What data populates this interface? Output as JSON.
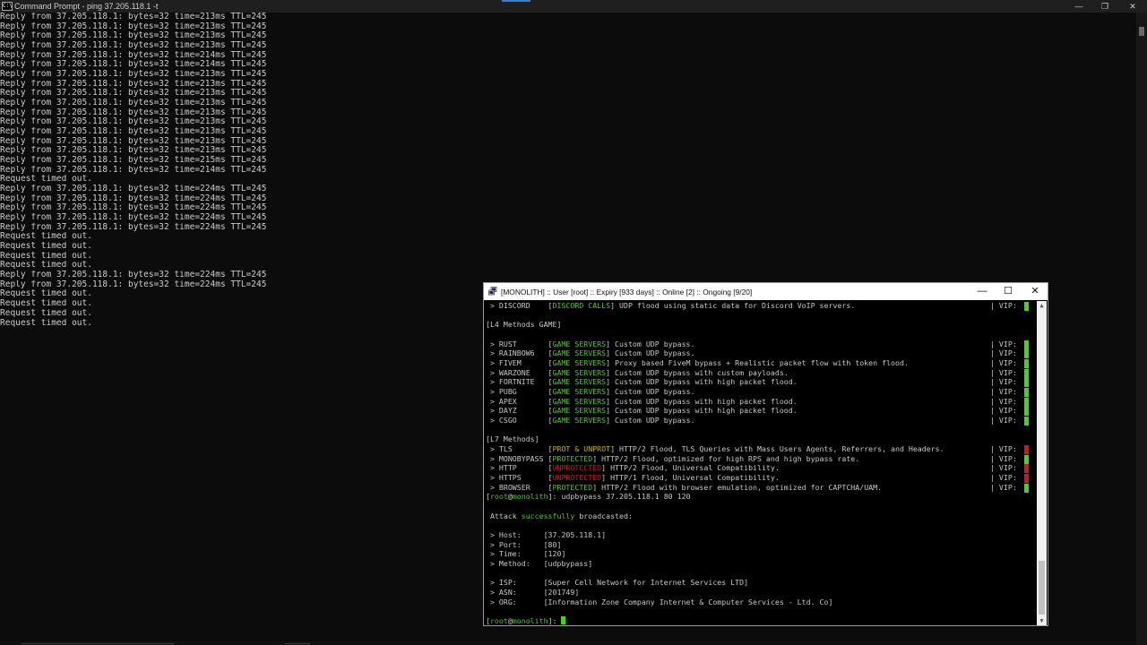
{
  "main_window": {
    "title": "Command Prompt - ping  37.205.118.1 -t",
    "controls": {
      "minimize": "—",
      "restore": "❐",
      "close": "✕"
    },
    "lines": [
      "Reply from 37.205.118.1: bytes=32 time=213ms TTL=245",
      "Reply from 37.205.118.1: bytes=32 time=213ms TTL=245",
      "Reply from 37.205.118.1: bytes=32 time=213ms TTL=245",
      "Reply from 37.205.118.1: bytes=32 time=213ms TTL=245",
      "Reply from 37.205.118.1: bytes=32 time=214ms TTL=245",
      "Reply from 37.205.118.1: bytes=32 time=214ms TTL=245",
      "Reply from 37.205.118.1: bytes=32 time=213ms TTL=245",
      "Reply from 37.205.118.1: bytes=32 time=213ms TTL=245",
      "Reply from 37.205.118.1: bytes=32 time=213ms TTL=245",
      "Reply from 37.205.118.1: bytes=32 time=213ms TTL=245",
      "Reply from 37.205.118.1: bytes=32 time=213ms TTL=245",
      "Reply from 37.205.118.1: bytes=32 time=213ms TTL=245",
      "Reply from 37.205.118.1: bytes=32 time=213ms TTL=245",
      "Reply from 37.205.118.1: bytes=32 time=213ms TTL=245",
      "Reply from 37.205.118.1: bytes=32 time=213ms TTL=245",
      "Reply from 37.205.118.1: bytes=32 time=215ms TTL=245",
      "Reply from 37.205.118.1: bytes=32 time=214ms TTL=245",
      "Request timed out.",
      "Reply from 37.205.118.1: bytes=32 time=224ms TTL=245",
      "Reply from 37.205.118.1: bytes=32 time=224ms TTL=245",
      "Reply from 37.205.118.1: bytes=32 time=224ms TTL=245",
      "Reply from 37.205.118.1: bytes=32 time=224ms TTL=245",
      "Reply from 37.205.118.1: bytes=32 time=224ms TTL=245",
      "Request timed out.",
      "Request timed out.",
      "Request timed out.",
      "Request timed out.",
      "Reply from 37.205.118.1: bytes=32 time=224ms TTL=245",
      "Reply from 37.205.118.1: bytes=32 time=224ms TTL=245",
      "Request timed out.",
      "Request timed out.",
      "Request timed out.",
      "Request timed out."
    ]
  },
  "putty_window": {
    "title": "[MONOLITH] :: User [root] :: Expiry [933 days] :: Online [2] :: Ongoing [9/20]",
    "controls": {
      "minimize": "—",
      "maximize": "☐",
      "close": "✕"
    },
    "colors": {
      "green": "#57c435",
      "yellow": "#c7b21b",
      "red": "#c62020",
      "vip_on": "#41d619",
      "vip_off": "#d01a1a"
    },
    "lines": [
      {
        "segs": [
          {
            "t": " > DISCORD    [",
            "c": "w"
          },
          {
            "t": "DISCORD CALLS",
            "c": "g"
          },
          {
            "t": "] UDP flood using static data for Discord VoIP servers.",
            "c": "w"
          }
        ],
        "vip": "on"
      },
      {
        "segs": []
      },
      {
        "segs": [
          {
            "t": "[L4 Methods GAME]",
            "c": "w"
          }
        ]
      },
      {
        "segs": []
      },
      {
        "segs": [
          {
            "t": " > RUST       [",
            "c": "w"
          },
          {
            "t": "GAME SERVERS",
            "c": "g"
          },
          {
            "t": "] Custom UDP bypass.",
            "c": "w"
          }
        ],
        "vip": "on"
      },
      {
        "segs": [
          {
            "t": " > RAINBOW6   [",
            "c": "w"
          },
          {
            "t": "GAME SERVERS",
            "c": "g"
          },
          {
            "t": "] Custom UDP bypass.",
            "c": "w"
          }
        ],
        "vip": "on"
      },
      {
        "segs": [
          {
            "t": " > FIVEM      [",
            "c": "w"
          },
          {
            "t": "GAME SERVERS",
            "c": "g"
          },
          {
            "t": "] Proxy based FiveM bypass + Realistic packet flow with token flood.",
            "c": "w"
          }
        ],
        "vip": "on"
      },
      {
        "segs": [
          {
            "t": " > WARZONE    [",
            "c": "w"
          },
          {
            "t": "GAME SERVERS",
            "c": "g"
          },
          {
            "t": "] Custom UDP bypass with custom payloads.",
            "c": "w"
          }
        ],
        "vip": "on"
      },
      {
        "segs": [
          {
            "t": " > FORTNITE   [",
            "c": "w"
          },
          {
            "t": "GAME SERVERS",
            "c": "g"
          },
          {
            "t": "] Custom UDP bypass with high packet flood.",
            "c": "w"
          }
        ],
        "vip": "on"
      },
      {
        "segs": [
          {
            "t": " > PUBG       [",
            "c": "w"
          },
          {
            "t": "GAME SERVERS",
            "c": "g"
          },
          {
            "t": "] Custom UDP bypass.",
            "c": "w"
          }
        ],
        "vip": "on"
      },
      {
        "segs": [
          {
            "t": " > APEX       [",
            "c": "w"
          },
          {
            "t": "GAME SERVERS",
            "c": "g"
          },
          {
            "t": "] Custom UDP bypass with high packet flood.",
            "c": "w"
          }
        ],
        "vip": "on"
      },
      {
        "segs": [
          {
            "t": " > DAYZ       [",
            "c": "w"
          },
          {
            "t": "GAME SERVERS",
            "c": "g"
          },
          {
            "t": "] Custom UDP bypass with high packet flood.",
            "c": "w"
          }
        ],
        "vip": "on"
      },
      {
        "segs": [
          {
            "t": " > CSGO       [",
            "c": "w"
          },
          {
            "t": "GAME SERVERS",
            "c": "g"
          },
          {
            "t": "] Custom UDP bypass.",
            "c": "w"
          }
        ],
        "vip": "on"
      },
      {
        "segs": []
      },
      {
        "segs": [
          {
            "t": "[L7 Methods]",
            "c": "w"
          }
        ]
      },
      {
        "segs": [
          {
            "t": " > TLS        [",
            "c": "w"
          },
          {
            "t": "PROT & UNPROT",
            "c": "y"
          },
          {
            "t": "] HTTP/2 Flood, TLS Queries with Mass Users Agents, Referrers, and Headers.",
            "c": "w"
          }
        ],
        "vip": "off"
      },
      {
        "segs": [
          {
            "t": " > MONOBYPASS [",
            "c": "w"
          },
          {
            "t": "PROTECTED",
            "c": "g"
          },
          {
            "t": "] HTTP/2 Flood, optimized for high RPS and high bypass rate.",
            "c": "w"
          }
        ],
        "vip": "on"
      },
      {
        "segs": [
          {
            "t": " > HTTP       [",
            "c": "w"
          },
          {
            "t": "UNPROTECTED",
            "c": "r"
          },
          {
            "t": "] HTTP/2 Flood, Universal Compatibility.",
            "c": "w"
          }
        ],
        "vip": "off"
      },
      {
        "segs": [
          {
            "t": " > HTTPS      [",
            "c": "w"
          },
          {
            "t": "UNPROTECTED",
            "c": "r"
          },
          {
            "t": "] HTTP/1 Flood, Universal Compatibility.",
            "c": "w"
          }
        ],
        "vip": "off"
      },
      {
        "segs": [
          {
            "t": " > BROWSER    [",
            "c": "w"
          },
          {
            "t": "PROTECTED",
            "c": "g"
          },
          {
            "t": "] HTTP/2 Flood with browser emulation, optimized for CAPTCHA/UAM.",
            "c": "w"
          }
        ],
        "vip": "on"
      },
      {
        "segs": [
          {
            "t": "[",
            "c": "w"
          },
          {
            "t": "root",
            "c": "g"
          },
          {
            "t": "@",
            "c": "w"
          },
          {
            "t": "monolith",
            "c": "g"
          },
          {
            "t": "]: udpbypass 37.205.118.1 80 120",
            "c": "w"
          }
        ]
      },
      {
        "segs": []
      },
      {
        "segs": [
          {
            "t": " Attack ",
            "c": "w"
          },
          {
            "t": "successfully",
            "c": "g"
          },
          {
            "t": " broadcasted:",
            "c": "w"
          }
        ]
      },
      {
        "segs": []
      },
      {
        "segs": [
          {
            "t": " > Host:     [37.205.118.1]",
            "c": "w"
          }
        ]
      },
      {
        "segs": [
          {
            "t": " > Port:     [80]",
            "c": "w"
          }
        ]
      },
      {
        "segs": [
          {
            "t": " > Time:     [120]",
            "c": "w"
          }
        ]
      },
      {
        "segs": [
          {
            "t": " > Method:   [udpbypass]",
            "c": "w"
          }
        ]
      },
      {
        "segs": []
      },
      {
        "segs": [
          {
            "t": " > ISP:      [Super Cell Network for Internet Services LTD]",
            "c": "w"
          }
        ]
      },
      {
        "segs": [
          {
            "t": " > ASN:      [201749]",
            "c": "w"
          }
        ]
      },
      {
        "segs": [
          {
            "t": " > ORG:      [Information Zone Company Internet & Computer Services - Ltd. Co]",
            "c": "w"
          }
        ]
      },
      {
        "segs": []
      },
      {
        "segs": [
          {
            "t": "[",
            "c": "w"
          },
          {
            "t": "root",
            "c": "g"
          },
          {
            "t": "@",
            "c": "w"
          },
          {
            "t": "monolith",
            "c": "g"
          },
          {
            "t": "]: ",
            "c": "w"
          }
        ],
        "cursor": true
      }
    ],
    "vip_label": "| VIP:",
    "scroll": {
      "up": "▲",
      "down": "▼"
    }
  },
  "icons": {
    "cmd": "command-prompt-icon",
    "putty": "putty-icon"
  }
}
